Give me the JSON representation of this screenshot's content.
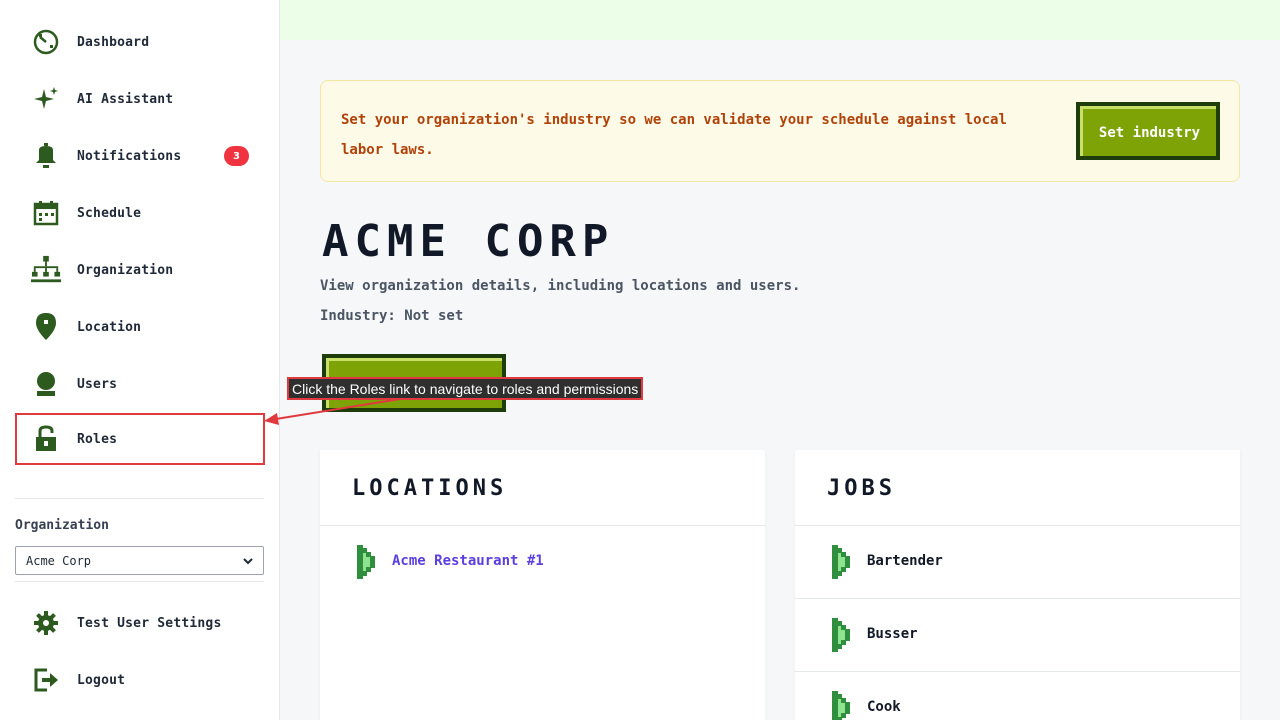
{
  "sidebar": {
    "items": [
      {
        "label": "Dashboard",
        "icon": "dashboard-icon"
      },
      {
        "label": "AI Assistant",
        "icon": "sparkle-icon"
      },
      {
        "label": "Notifications",
        "icon": "bell-icon",
        "badge": "3"
      },
      {
        "label": "Schedule",
        "icon": "calendar-icon"
      },
      {
        "label": "Organization",
        "icon": "org-chart-icon"
      },
      {
        "label": "Location",
        "icon": "location-pin-icon"
      },
      {
        "label": "Users",
        "icon": "user-icon"
      },
      {
        "label": "Roles",
        "icon": "lock-icon"
      }
    ],
    "org_label": "Organization",
    "org_selected": "Acme Corp",
    "bottom_items": [
      {
        "label": "Test User Settings",
        "icon": "gear-icon"
      },
      {
        "label": "Logout",
        "icon": "logout-icon"
      }
    ]
  },
  "banner": {
    "text": "Set your organization's industry so we can validate your schedule against local labor laws.",
    "button_label": "Set industry"
  },
  "page": {
    "title": "ACME CORP",
    "description": "View organization details, including locations and users.",
    "industry": "Industry: Not set"
  },
  "tooltip": "Click the Roles link to navigate to roles and permissions",
  "locations_card": {
    "title": "LOCATIONS",
    "items": [
      "Acme Restaurant #1"
    ]
  },
  "jobs_card": {
    "title": "JOBS",
    "items": [
      "Bartender",
      "Busser",
      "Cook"
    ]
  },
  "colors": {
    "icon_green": "#2d5a1f",
    "accent_green": "#7da307",
    "badge_red": "#ef3340",
    "link_purple": "#5b3fe0"
  }
}
